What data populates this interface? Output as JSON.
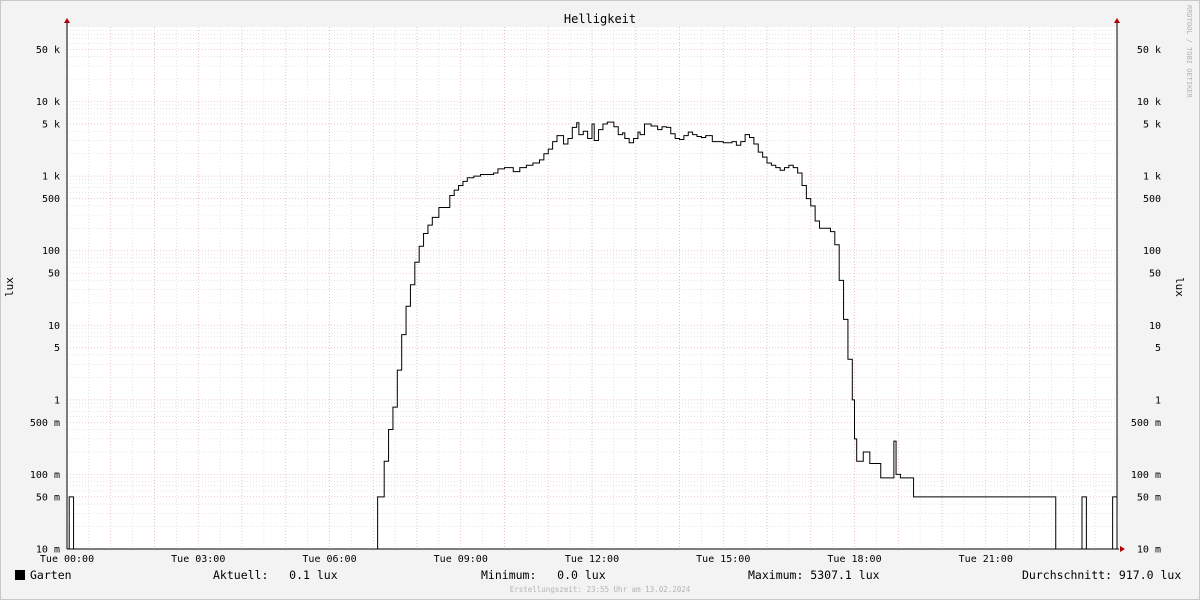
{
  "chart_data": {
    "type": "line",
    "title": "Helligkeit",
    "ylabel": "lux",
    "watermark": "RRDTOOL / TOBI OETIKER",
    "x_range_hours": [
      0,
      24
    ],
    "ylim": [
      0.01,
      100000
    ],
    "y_scale": "log",
    "grid": true,
    "x_ticks": [
      {
        "hour": 0,
        "label": "Tue 00:00"
      },
      {
        "hour": 3,
        "label": "Tue 03:00"
      },
      {
        "hour": 6,
        "label": "Tue 06:00"
      },
      {
        "hour": 9,
        "label": "Tue 09:00"
      },
      {
        "hour": 12,
        "label": "Tue 12:00"
      },
      {
        "hour": 15,
        "label": "Tue 15:00"
      },
      {
        "hour": 18,
        "label": "Tue 18:00"
      },
      {
        "hour": 21,
        "label": "Tue 21:00"
      }
    ],
    "y_ticks": [
      {
        "value": 0.01,
        "label": "10 m"
      },
      {
        "value": 0.05,
        "label": "50 m"
      },
      {
        "value": 0.1,
        "label": "100 m"
      },
      {
        "value": 0.5,
        "label": "500 m"
      },
      {
        "value": 1,
        "label": "1"
      },
      {
        "value": 5,
        "label": "5"
      },
      {
        "value": 10,
        "label": "10"
      },
      {
        "value": 50,
        "label": "50"
      },
      {
        "value": 100,
        "label": "100"
      },
      {
        "value": 500,
        "label": "500"
      },
      {
        "value": 1000,
        "label": "1 k"
      },
      {
        "value": 5000,
        "label": "5 k"
      },
      {
        "value": 10000,
        "label": "10 k"
      },
      {
        "value": 50000,
        "label": "50 k"
      }
    ],
    "series": [
      {
        "name": "Garten",
        "color": "#000000",
        "step": true,
        "points": [
          [
            0.0,
            0.01
          ],
          [
            0.05,
            0.05
          ],
          [
            0.15,
            0.01
          ],
          [
            7.08,
            0.01
          ],
          [
            7.1,
            0.05
          ],
          [
            7.25,
            0.15
          ],
          [
            7.35,
            0.4
          ],
          [
            7.45,
            0.8
          ],
          [
            7.55,
            2.5
          ],
          [
            7.65,
            7.5
          ],
          [
            7.75,
            18
          ],
          [
            7.85,
            35
          ],
          [
            7.95,
            70
          ],
          [
            8.05,
            115
          ],
          [
            8.15,
            170
          ],
          [
            8.25,
            220
          ],
          [
            8.35,
            280
          ],
          [
            8.5,
            380
          ],
          [
            8.65,
            380
          ],
          [
            8.75,
            550
          ],
          [
            8.85,
            650
          ],
          [
            8.95,
            750
          ],
          [
            9.05,
            850
          ],
          [
            9.15,
            950
          ],
          [
            9.3,
            1000
          ],
          [
            9.45,
            1050
          ],
          [
            9.6,
            1050
          ],
          [
            9.75,
            1100
          ],
          [
            9.85,
            1250
          ],
          [
            10.0,
            1300
          ],
          [
            10.2,
            1150
          ],
          [
            10.35,
            1300
          ],
          [
            10.5,
            1400
          ],
          [
            10.65,
            1500
          ],
          [
            10.8,
            1650
          ],
          [
            10.9,
            2000
          ],
          [
            11.0,
            2300
          ],
          [
            11.1,
            2900
          ],
          [
            11.2,
            3500
          ],
          [
            11.35,
            2700
          ],
          [
            11.45,
            3200
          ],
          [
            11.55,
            4500
          ],
          [
            11.65,
            5200
          ],
          [
            11.7,
            3600
          ],
          [
            11.8,
            4000
          ],
          [
            11.9,
            3200
          ],
          [
            12.0,
            5000
          ],
          [
            12.05,
            3000
          ],
          [
            12.15,
            4200
          ],
          [
            12.25,
            5000
          ],
          [
            12.35,
            5300
          ],
          [
            12.5,
            4600
          ],
          [
            12.6,
            3600
          ],
          [
            12.7,
            3800
          ],
          [
            12.75,
            3200
          ],
          [
            12.85,
            2800
          ],
          [
            12.95,
            3200
          ],
          [
            13.05,
            3900
          ],
          [
            13.1,
            3600
          ],
          [
            13.2,
            5000
          ],
          [
            13.35,
            4700
          ],
          [
            13.5,
            4200
          ],
          [
            13.6,
            4600
          ],
          [
            13.7,
            4500
          ],
          [
            13.8,
            3700
          ],
          [
            13.9,
            3200
          ],
          [
            14.0,
            3100
          ],
          [
            14.1,
            3500
          ],
          [
            14.2,
            3900
          ],
          [
            14.3,
            3600
          ],
          [
            14.4,
            3400
          ],
          [
            14.5,
            3300
          ],
          [
            14.6,
            3500
          ],
          [
            14.75,
            2900
          ],
          [
            15.0,
            2800
          ],
          [
            15.2,
            2900
          ],
          [
            15.3,
            2600
          ],
          [
            15.4,
            2900
          ],
          [
            15.5,
            3600
          ],
          [
            15.6,
            3300
          ],
          [
            15.7,
            2700
          ],
          [
            15.8,
            2100
          ],
          [
            15.9,
            1800
          ],
          [
            16.0,
            1500
          ],
          [
            16.1,
            1400
          ],
          [
            16.2,
            1300
          ],
          [
            16.3,
            1200
          ],
          [
            16.4,
            1300
          ],
          [
            16.5,
            1400
          ],
          [
            16.6,
            1300
          ],
          [
            16.7,
            1100
          ],
          [
            16.8,
            750
          ],
          [
            16.9,
            500
          ],
          [
            17.0,
            400
          ],
          [
            17.1,
            250
          ],
          [
            17.2,
            200
          ],
          [
            17.35,
            200
          ],
          [
            17.45,
            180
          ],
          [
            17.55,
            120
          ],
          [
            17.65,
            40
          ],
          [
            17.75,
            12
          ],
          [
            17.85,
            3.5
          ],
          [
            17.95,
            1
          ],
          [
            18.0,
            0.3
          ],
          [
            18.05,
            0.15
          ],
          [
            18.2,
            0.2
          ],
          [
            18.35,
            0.14
          ],
          [
            18.5,
            0.14
          ],
          [
            18.6,
            0.09
          ],
          [
            18.75,
            0.09
          ],
          [
            18.85,
            0.09
          ],
          [
            18.9,
            0.28
          ],
          [
            18.95,
            0.1
          ],
          [
            19.05,
            0.09
          ],
          [
            19.3,
            0.09
          ],
          [
            19.35,
            0.05
          ],
          [
            22.55,
            0.05
          ],
          [
            22.6,
            0.01
          ],
          [
            23.15,
            0.01
          ],
          [
            23.2,
            0.05
          ],
          [
            23.3,
            0.01
          ],
          [
            23.85,
            0.01
          ],
          [
            23.9,
            0.05
          ],
          [
            24.0,
            0.05
          ]
        ]
      }
    ]
  },
  "legend": {
    "swatch_color": "#000000",
    "name": "Garten"
  },
  "stats": {
    "current": "Aktuell:   0.1 lux",
    "minimum": "Minimum:   0.0 lux",
    "maximum": "Maximum: 5307.1 lux",
    "average": "Durchschnitt: 917.0 lux"
  },
  "creation_text": "Erstellungszeit: 23:55 Uhr am 13.02.2024",
  "colors": {
    "major_grid": "#e6b0b8",
    "minor_grid": "#d4d4d4",
    "background": "#f3f3f3",
    "plot_bg": "#ffffff",
    "arrow": "#b00000"
  }
}
